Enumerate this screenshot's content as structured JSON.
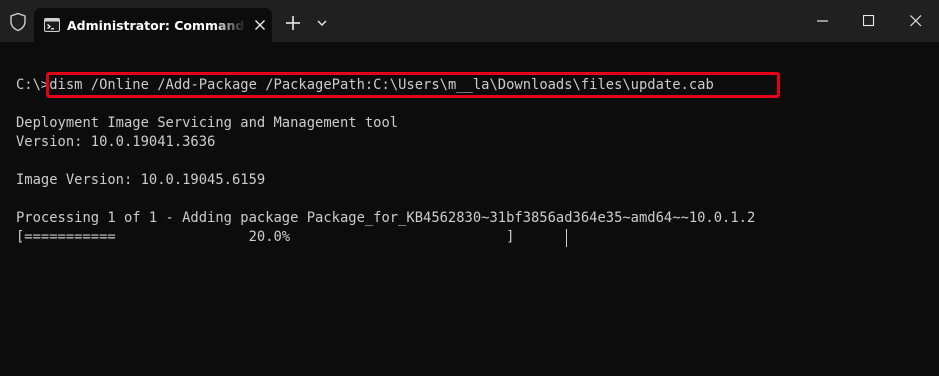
{
  "window": {
    "tab_title": "Administrator: Command Prompt",
    "icons": {
      "shield": "shield-icon",
      "tab": "terminal-icon",
      "tab_close": "close-icon",
      "new_tab": "plus-icon",
      "dropdown": "chevron-down-icon",
      "minimize": "minimize-icon",
      "maximize": "maximize-icon",
      "close": "close-icon"
    }
  },
  "terminal": {
    "prompt": "C:\\>",
    "command": "dism /Online /Add-Package /PackagePath:C:\\Users\\m__la\\Downloads\\files\\update.cab",
    "tool_name": "Deployment Image Servicing and Management tool",
    "version": "Version: 10.0.19041.3636",
    "image_version": "Image Version: 10.0.19045.6159",
    "processing": "Processing 1 of 1 - Adding package Package_for_KB4562830~31bf3856ad364e35~amd64~~10.0.1.2",
    "progress_bar": "[===========                20.0%                          ]",
    "progress_fraction": 0.2
  },
  "colors": {
    "background": "#0c0c0c",
    "titlebar": "#202020",
    "text": "#cccccc",
    "highlight": "#e3001b"
  }
}
